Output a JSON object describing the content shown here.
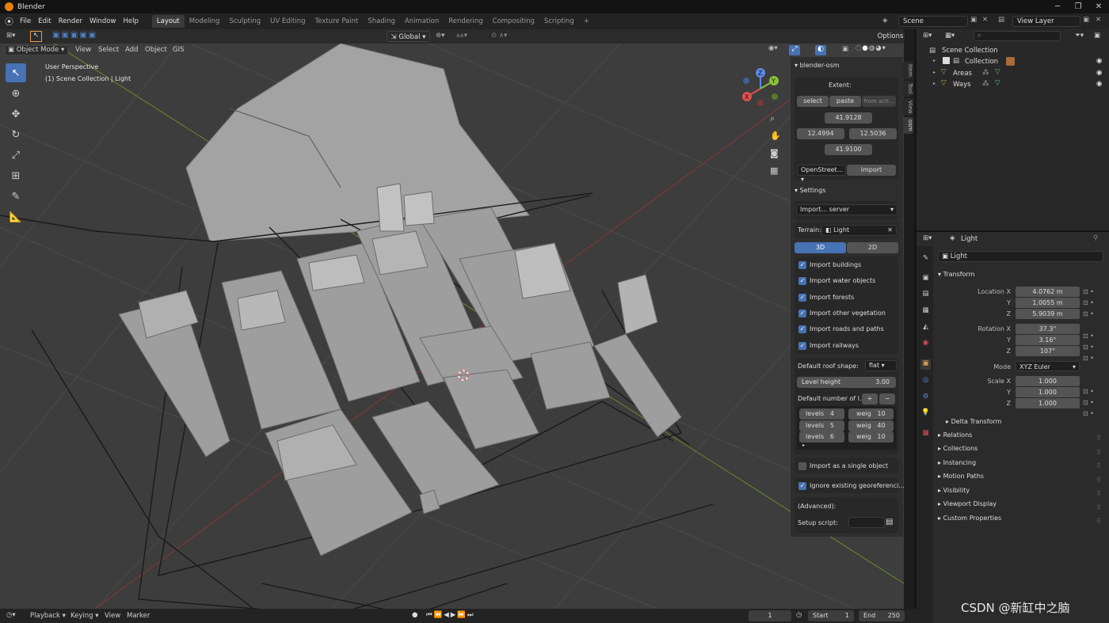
{
  "window": {
    "title": "Blender",
    "minimize": "─",
    "maximize": "❐",
    "close": "✕"
  },
  "menu": [
    "File",
    "Edit",
    "Render",
    "Window",
    "Help"
  ],
  "workspaces": [
    "Layout",
    "Modeling",
    "Sculpting",
    "UV Editing",
    "Texture Paint",
    "Shading",
    "Animation",
    "Rendering",
    "Compositing",
    "Scripting",
    "+"
  ],
  "scene": {
    "name": "Scene",
    "view_layer": "View Layer"
  },
  "viewport": {
    "transform_orientation": "Global",
    "options_label": "Options",
    "mode": "Object Mode",
    "menus": [
      "View",
      "Select",
      "Add",
      "Object",
      "GIS"
    ],
    "perspective": "User Perspective",
    "collection_info": "(1) Scene Collection | Light",
    "gizmo": {
      "x": "X",
      "y": "Y",
      "z": "Z"
    }
  },
  "npanel": {
    "tabs": [
      "Item",
      "Tool",
      "View",
      "osm"
    ],
    "addon_title": "blender-osm",
    "extent_label": "Extent:",
    "select_btn": "select",
    "paste_btn": "paste",
    "from_btn": "from acti...",
    "north": "41.9128",
    "west": "12.4994",
    "east": "12.5036",
    "south": "41.9100",
    "source": "OpenStreet...",
    "import_btn": "import",
    "settings_title": "Settings",
    "import_from_label": "Import...",
    "import_from_value": "server",
    "terrain_label": "Terrain:",
    "terrain_value": "Light",
    "mode_3d": "3D",
    "mode_2d": "2D",
    "checks": [
      {
        "label": "Import buildings",
        "checked": true
      },
      {
        "label": "Import water objects",
        "checked": true
      },
      {
        "label": "Import forests",
        "checked": true
      },
      {
        "label": "Import other vegetation",
        "checked": true
      },
      {
        "label": "Import roads and paths",
        "checked": true
      },
      {
        "label": "Import railways",
        "checked": true
      }
    ],
    "roof_label": "Default roof shape:",
    "roof_value": "flat",
    "level_height_label": "Level height",
    "level_height_value": "3.00",
    "num_levels_label": "Default number of l...",
    "levels": [
      {
        "levels": "levels",
        "lv": "4",
        "weight": "weig",
        "wv": "10"
      },
      {
        "levels": "levels",
        "lv": "5",
        "weight": "weig",
        "wv": "40"
      },
      {
        "levels": "levels",
        "lv": "6",
        "weight": "weig",
        "wv": "10"
      }
    ],
    "single_object_label": "Import as a single object",
    "ignore_geo_label": "Ignore existing georeferenci...",
    "advanced_label": "(Advanced):",
    "setup_script_label": "Setup script:"
  },
  "outliner": {
    "root": "Scene Collection",
    "items": [
      {
        "label": "Collection"
      },
      {
        "label": "Areas"
      },
      {
        "label": "Ways"
      }
    ]
  },
  "properties": {
    "object_name": "Light",
    "data_name": "Light",
    "transform_title": "Transform",
    "location_x_label": "Location X",
    "location_x": "4.0762 m",
    "location_y_label": "Y",
    "location_y": "1.0055 m",
    "location_z_label": "Z",
    "location_z": "5.9039 m",
    "rotation_x_label": "Rotation X",
    "rotation_x": "37.3°",
    "rotation_y_label": "Y",
    "rotation_y": "3.16°",
    "rotation_z_label": "Z",
    "rotation_z": "107°",
    "mode_label": "Mode",
    "mode_value": "XYZ Euler",
    "scale_x_label": "Scale X",
    "scale_x": "1.000",
    "scale_y_label": "Y",
    "scale_y": "1.000",
    "scale_z_label": "Z",
    "scale_z": "1.000",
    "delta_transform": "Delta Transform",
    "sections": [
      "Relations",
      "Collections",
      "Instancing",
      "Motion Paths",
      "Visibility",
      "Viewport Display",
      "Custom Properties"
    ]
  },
  "timeline": {
    "menus": [
      "Playback",
      "Keying",
      "View",
      "Marker"
    ],
    "current_frame": "1",
    "start_label": "Start",
    "start": "1",
    "end_label": "End",
    "end": "250"
  },
  "watermark": "CSDN @新缸中之脑",
  "colors": {
    "accent": "#4772b3",
    "orange": "#e87d0d",
    "bg": "#3d3d3d"
  }
}
